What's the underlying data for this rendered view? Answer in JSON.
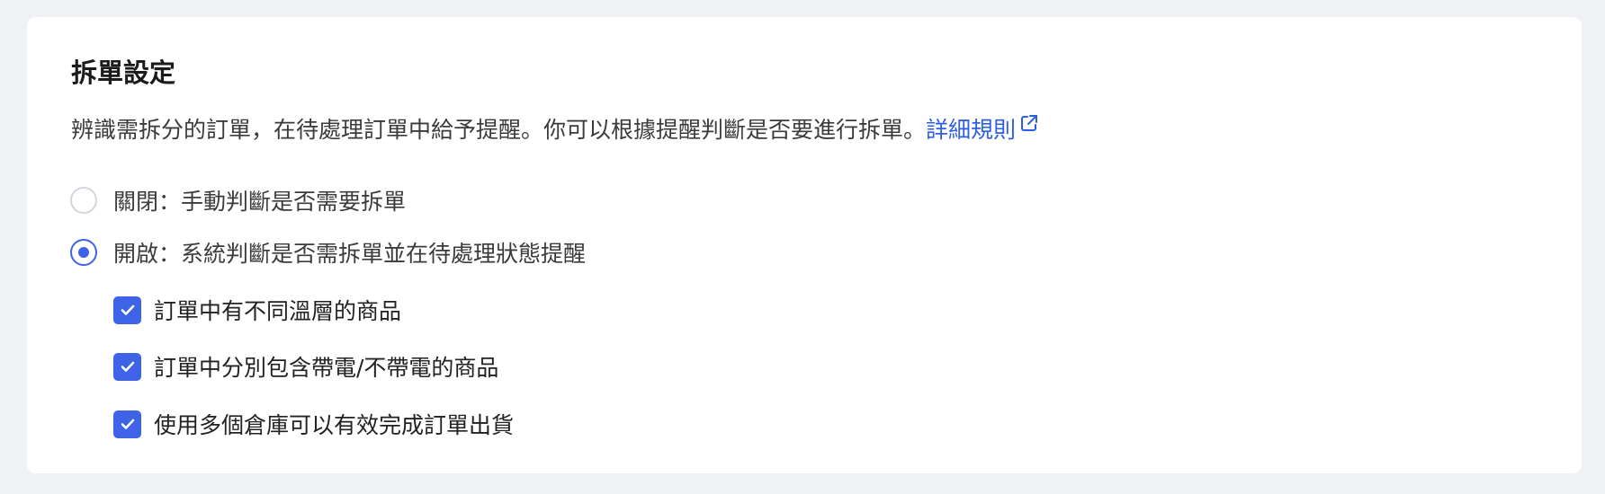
{
  "section": {
    "title": "拆單設定",
    "description": "辨識需拆分的訂單，在待處理訂單中給予提醒。你可以根據提醒判斷是否要進行拆單。",
    "detail_link_label": "詳細規則",
    "link_icon": "external-link-icon"
  },
  "options": {
    "off": {
      "label": "關閉：手動判斷是否需要拆單",
      "selected": false
    },
    "on": {
      "label": "開啟：系統判斷是否需拆單並在待處理狀態提醒",
      "selected": true
    }
  },
  "conditions": [
    {
      "label": "訂單中有不同溫層的商品",
      "checked": true
    },
    {
      "label": "訂單中分別包含帶電/不帶電的商品",
      "checked": true
    },
    {
      "label": "使用多個倉庫可以有效完成訂單出貨",
      "checked": true
    }
  ],
  "colors": {
    "accent": "#3f63e7",
    "link": "#2e5ee6",
    "background": "#f0f1f5",
    "card": "#ffffff"
  }
}
